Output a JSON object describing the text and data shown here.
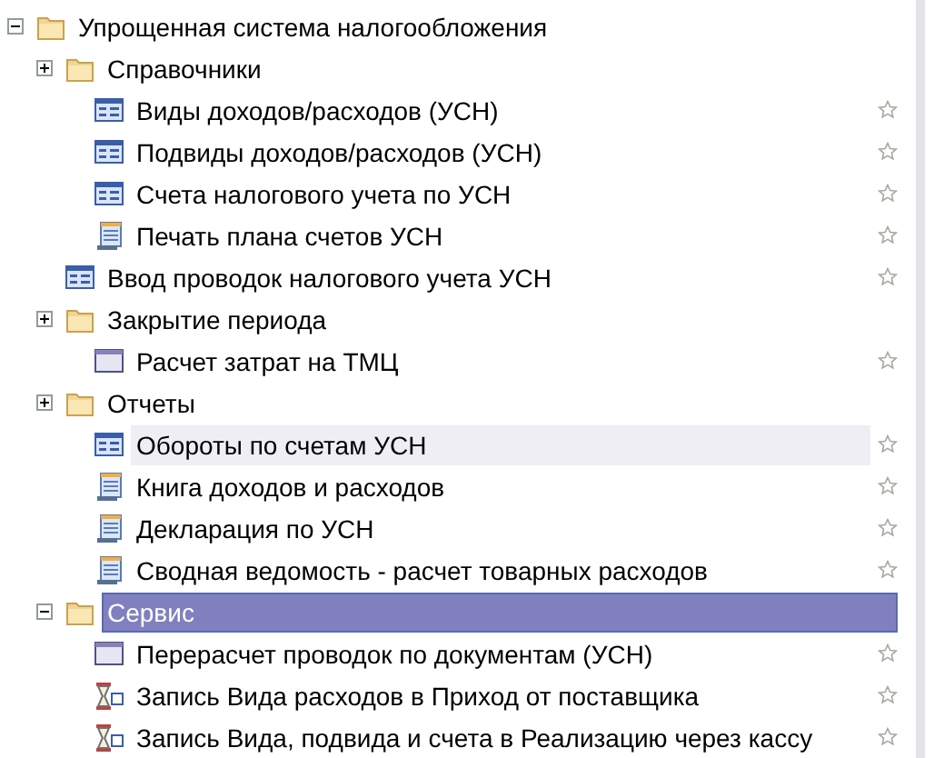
{
  "tree": [
    {
      "kind": "folder",
      "label": "Упрощенная система налогообложения",
      "expanded": true,
      "selected": false,
      "highlighted": false,
      "children": [
        {
          "kind": "folder",
          "label": "Справочники",
          "expanded": false,
          "selected": false,
          "highlighted": false,
          "children": [
            {
              "kind": "catalog",
              "label": "Виды доходов/расходов (УСН)",
              "selected": false,
              "highlighted": false
            },
            {
              "kind": "catalog",
              "label": "Подвиды доходов/расходов (УСН)",
              "selected": false,
              "highlighted": false
            },
            {
              "kind": "catalog",
              "label": "Счета налогового учета по УСН",
              "selected": false,
              "highlighted": false
            },
            {
              "kind": "report",
              "label": "Печать плана счетов УСН",
              "selected": false,
              "highlighted": false
            }
          ]
        },
        {
          "kind": "catalog",
          "label": "Ввод проводок налогового учета УСН",
          "selected": false,
          "highlighted": false
        },
        {
          "kind": "folder",
          "label": "Закрытие периода",
          "expanded": false,
          "selected": false,
          "highlighted": false,
          "children": [
            {
              "kind": "processing",
              "label": "Расчет затрат на ТМЦ",
              "selected": false,
              "highlighted": false
            }
          ]
        },
        {
          "kind": "folder",
          "label": "Отчеты",
          "expanded": false,
          "selected": false,
          "highlighted": false,
          "children": [
            {
              "kind": "catalog",
              "label": "Обороты по счетам УСН",
              "selected": false,
              "highlighted": true
            },
            {
              "kind": "report",
              "label": "Книга доходов и расходов",
              "selected": false,
              "highlighted": false
            },
            {
              "kind": "report",
              "label": "Декларация по УСН",
              "selected": false,
              "highlighted": false
            },
            {
              "kind": "report",
              "label": "Сводная ведомость - расчет товарных расходов",
              "selected": false,
              "highlighted": false
            }
          ]
        },
        {
          "kind": "folder",
          "label": "Сервис",
          "expanded": true,
          "selected": true,
          "highlighted": false,
          "children": [
            {
              "kind": "processing",
              "label": "Перерасчет проводок по документам (УСН)",
              "selected": false,
              "highlighted": false
            },
            {
              "kind": "routine",
              "label": "Запись Вида расходов в Приход от поставщика",
              "selected": false,
              "highlighted": false
            },
            {
              "kind": "routine",
              "label": "Запись Вида, подвида и счета в Реализацию через кассу",
              "selected": false,
              "highlighted": false
            }
          ]
        }
      ]
    }
  ]
}
